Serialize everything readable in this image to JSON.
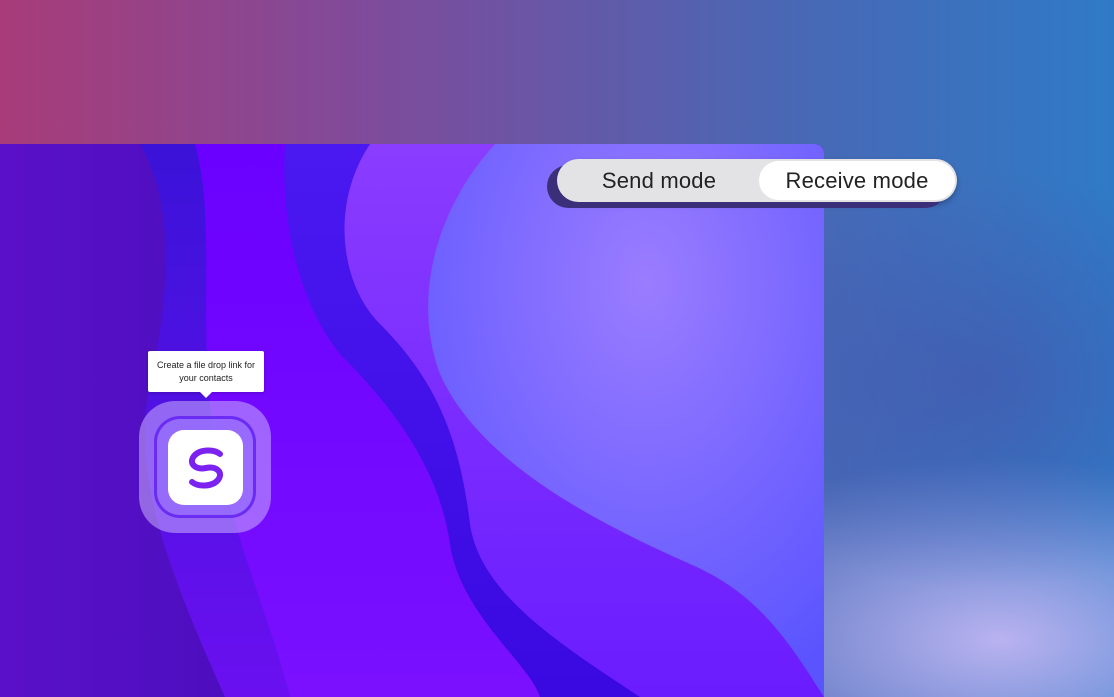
{
  "mode_toggle": {
    "send_label": "Send mode",
    "receive_label": "Receive mode",
    "selected": "Receive mode"
  },
  "tooltip": {
    "text": "Create a file drop link for your contacts"
  },
  "app_icon": {
    "icon": "swisstransfer-s-logo-icon",
    "color": "#7b22f0"
  },
  "colors": {
    "accent": "#7b22f0",
    "toggle_bg": "#e3e3e6",
    "toggle_selected": "#ffffff"
  }
}
